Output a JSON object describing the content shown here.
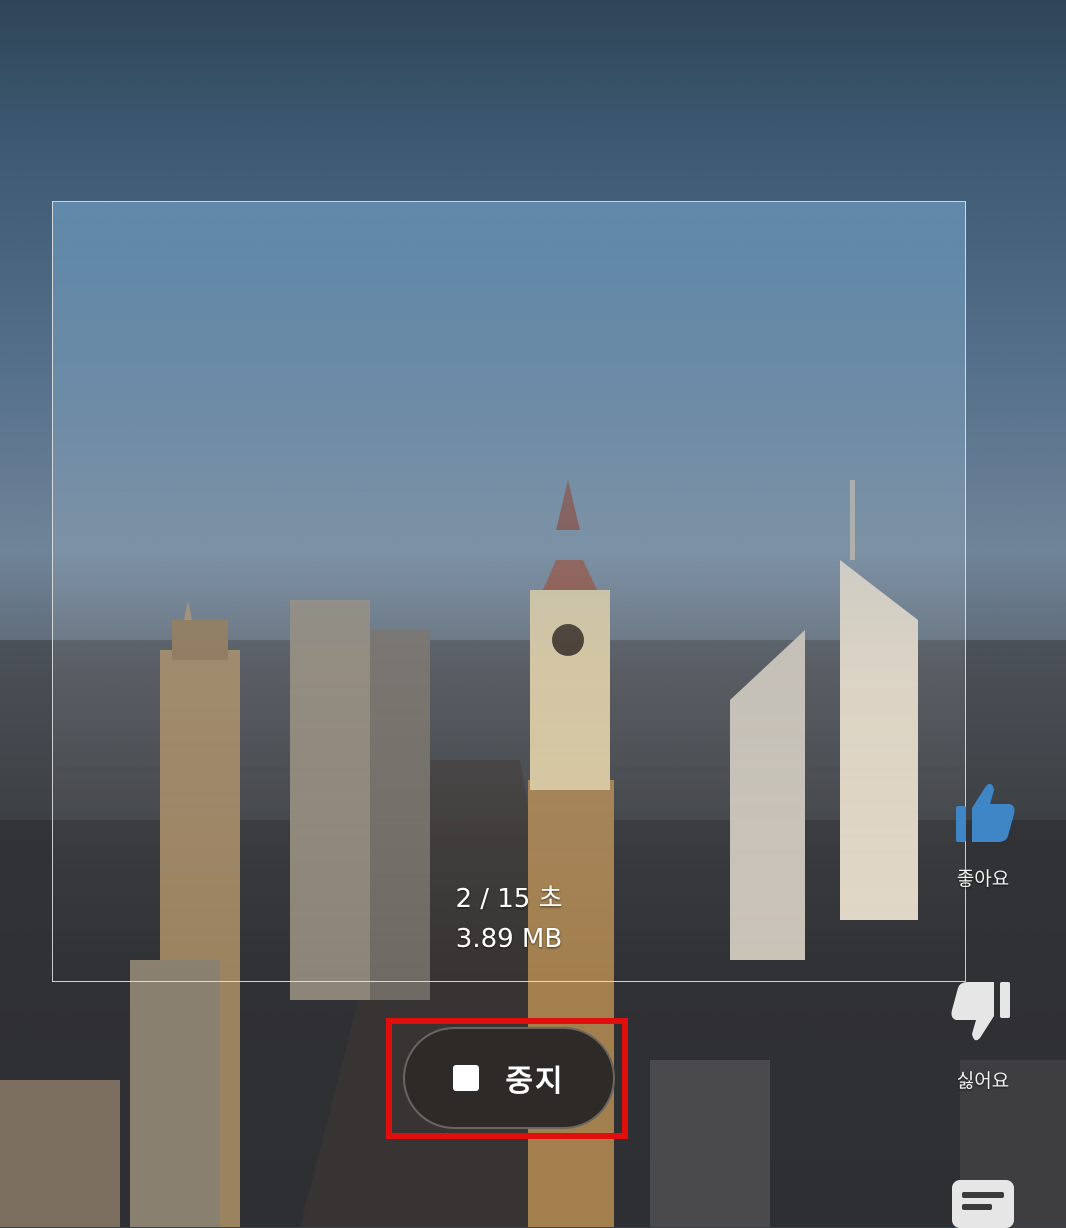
{
  "capture": {
    "time": "2 / 15 초",
    "size": "3.89 MB"
  },
  "stop_button": {
    "label": "중지"
  },
  "side_actions": {
    "like_label": "좋아요",
    "dislike_label": "싫어요"
  },
  "colors": {
    "highlight": "#e10e0e",
    "like": "#3f86c6"
  },
  "icons": [
    "stop-icon",
    "thumbs-up-icon",
    "thumbs-down-icon",
    "comment-icon"
  ]
}
